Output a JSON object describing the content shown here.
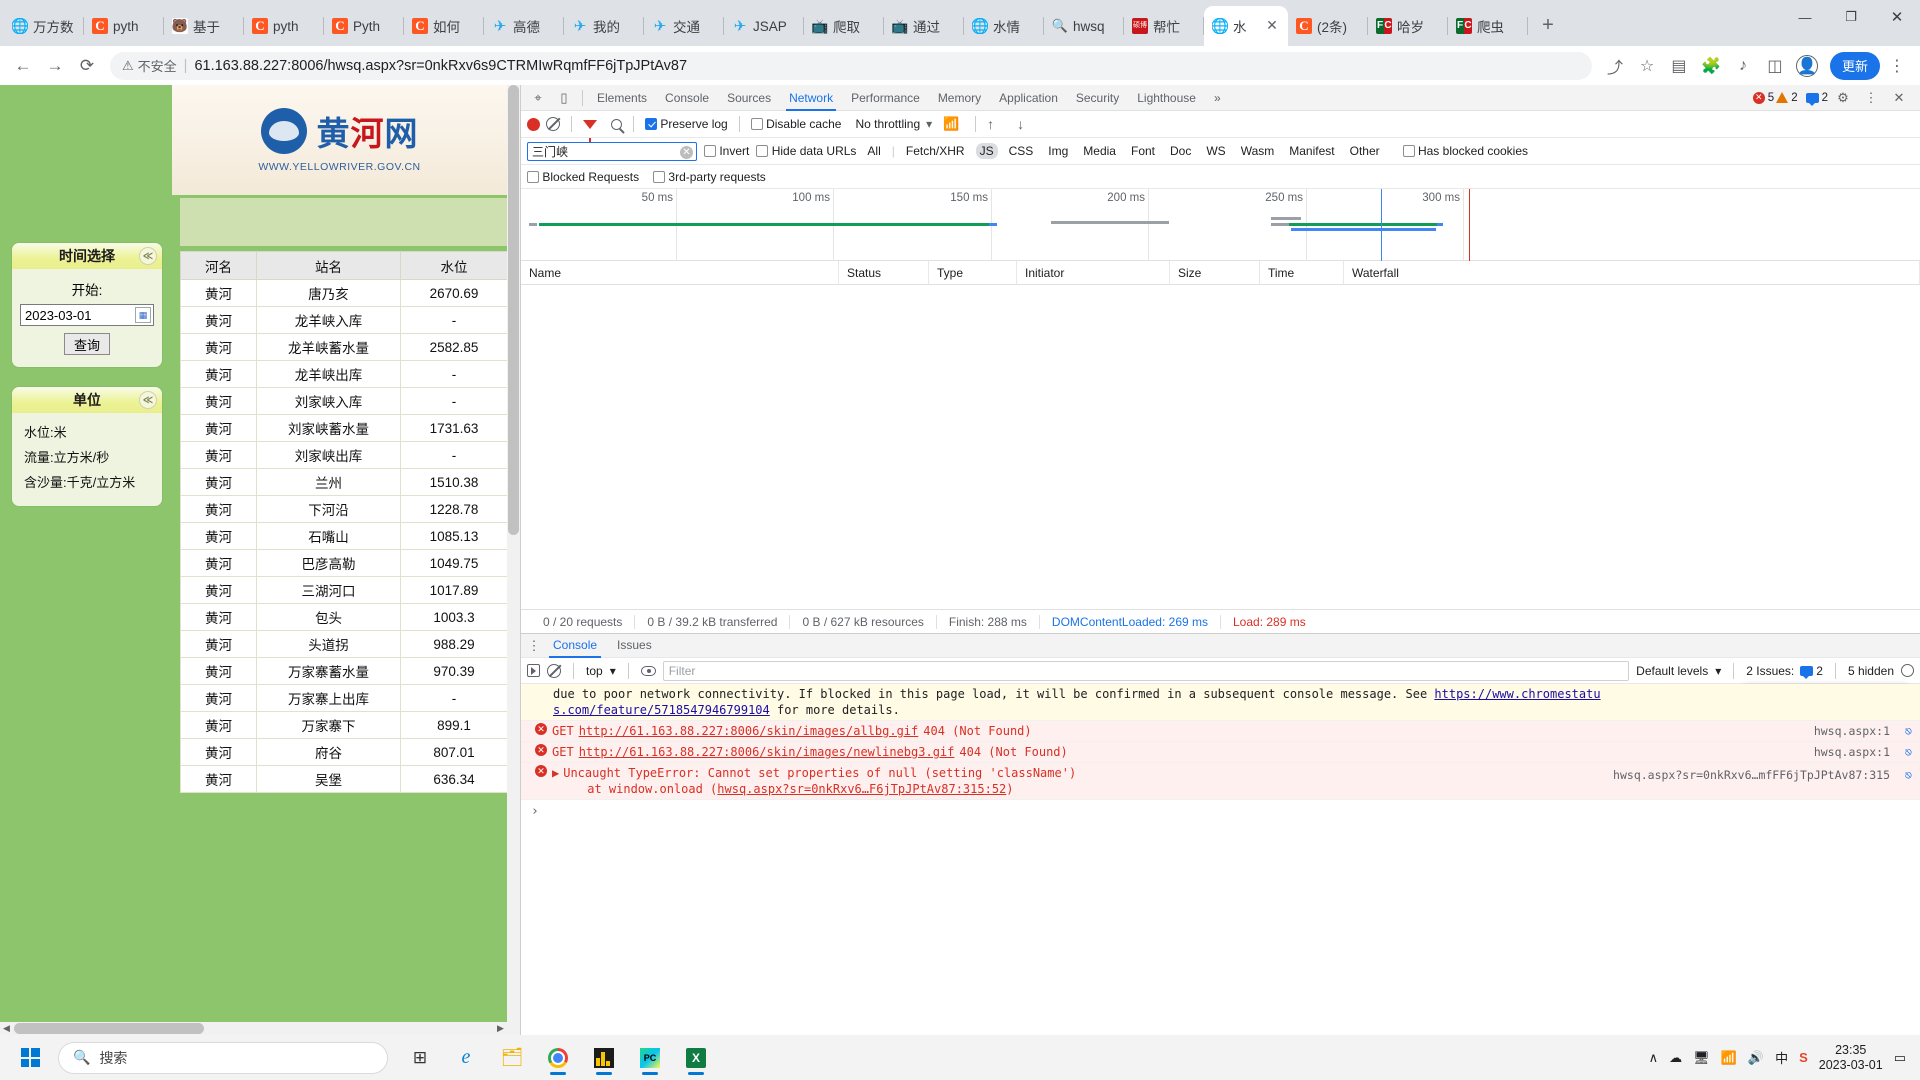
{
  "browser": {
    "tabs": [
      {
        "title": "万方数",
        "icon": "globe-icon"
      },
      {
        "title": "pyth",
        "icon": "csdn-icon"
      },
      {
        "title": "基于",
        "icon": "baidu-icon"
      },
      {
        "title": "pyth",
        "icon": "csdn-icon"
      },
      {
        "title": "Pyth",
        "icon": "csdn-icon"
      },
      {
        "title": "如何",
        "icon": "csdn-icon"
      },
      {
        "title": "高德",
        "icon": "telegram-icon"
      },
      {
        "title": "我的",
        "icon": "telegram-icon"
      },
      {
        "title": "交通",
        "icon": "telegram-icon"
      },
      {
        "title": "JSAP",
        "icon": "telegram-icon"
      },
      {
        "title": "爬取",
        "icon": "bilibili-icon"
      },
      {
        "title": "通过",
        "icon": "bilibili-icon"
      },
      {
        "title": "水情",
        "icon": "globe-icon"
      },
      {
        "title": "hwsq",
        "icon": "search-icon"
      },
      {
        "title": "帮忙",
        "icon": "doc-red-icon"
      },
      {
        "title": "水",
        "icon": "globe-icon",
        "active": true
      },
      {
        "title": "(2条)",
        "icon": "csdn-icon"
      },
      {
        "title": "哈岁",
        "icon": "fc-icon"
      },
      {
        "title": "爬虫",
        "icon": "fc-icon"
      }
    ],
    "new_tab_label": "+",
    "window_controls": {
      "minimize": "—",
      "maximize": "❐",
      "close": "✕"
    },
    "toolbar": {
      "back": "←",
      "forward": "→",
      "reload": "⟳",
      "security_label": "不安全",
      "url": "61.163.88.227:8006/hwsq.aspx?sr=0nkRxv6s9CTRMIwRqmfFF6jTpJPtAv87",
      "share_icon": "share-icon",
      "star_icon": "star-icon",
      "sidepanel_icon": "sidepanel-icon",
      "extensions_icon": "puzzle-icon",
      "media_icon": "media-icon",
      "collections_icon": "collections-icon",
      "profile_icon": "profile-icon",
      "update_label": "更新",
      "menu_icon": "kebab-menu-icon"
    }
  },
  "webpage": {
    "logo": {
      "text_black": "黄",
      "text_red": "河",
      "text_black2": "网",
      "subtitle": "WWW.YELLOWRIVER.GOV.CN"
    },
    "time_panel": {
      "title": "时间选择",
      "start_label": "开始:",
      "date_value": "2023-03-01",
      "query_label": "查询",
      "collapse_icon": "chevron-up-icon",
      "calendar_icon": "calendar-icon"
    },
    "unit_panel": {
      "title": "单位",
      "collapse_icon": "chevron-up-icon",
      "lines": [
        "水位:米",
        "流量:立方米/秒",
        "含沙量:千克/立方米"
      ]
    },
    "table": {
      "headers": [
        "河名",
        "站名",
        "水位"
      ],
      "rows": [
        [
          "黄河",
          "唐乃亥",
          "2670.69"
        ],
        [
          "黄河",
          "龙羊峡入库",
          "-"
        ],
        [
          "黄河",
          "龙羊峡蓄水量",
          "2582.85"
        ],
        [
          "黄河",
          "龙羊峡出库",
          "-"
        ],
        [
          "黄河",
          "刘家峡入库",
          "-"
        ],
        [
          "黄河",
          "刘家峡蓄水量",
          "1731.63"
        ],
        [
          "黄河",
          "刘家峡出库",
          "-"
        ],
        [
          "黄河",
          "兰州",
          "1510.38"
        ],
        [
          "黄河",
          "下河沿",
          "1228.78"
        ],
        [
          "黄河",
          "石嘴山",
          "1085.13"
        ],
        [
          "黄河",
          "巴彦高勒",
          "1049.75"
        ],
        [
          "黄河",
          "三湖河口",
          "1017.89"
        ],
        [
          "黄河",
          "包头",
          "1003.3"
        ],
        [
          "黄河",
          "头道拐",
          "988.29"
        ],
        [
          "黄河",
          "万家寨蓄水量",
          "970.39"
        ],
        [
          "黄河",
          "万家寨上出库",
          "-"
        ],
        [
          "黄河",
          "万家寨下",
          "899.1"
        ],
        [
          "黄河",
          "府谷",
          "807.01"
        ],
        [
          "黄河",
          "吴堡",
          "636.34"
        ]
      ]
    }
  },
  "devtools": {
    "panel_tabs": [
      "Elements",
      "Console",
      "Sources",
      "Network",
      "Performance",
      "Memory",
      "Application",
      "Security",
      "Lighthouse"
    ],
    "selected_panel": "Network",
    "overflow_label": "»",
    "inspect_icon": "inspect-cursor-icon",
    "device_icon": "device-toolbar-icon",
    "settings_icon": "gear-icon",
    "more_icon": "kebab-menu-icon",
    "close_icon": "close-icon",
    "counters": {
      "errors": "5",
      "warnings": "2",
      "messages": "2"
    },
    "network_toolbar": {
      "record_label": "record-button",
      "clear_label": "clear-button",
      "filter_icon": "funnel-icon",
      "search_icon": "search-icon",
      "preserve_log": "Preserve log",
      "preserve_log_checked": true,
      "disable_cache": "Disable cache",
      "disable_cache_checked": false,
      "throttling": "No throttling",
      "wifi_icon": "network-conditions-icon",
      "import_icon": "import-har-icon",
      "export_icon": "export-har-icon"
    },
    "filter_bar": {
      "filter_value": "三门峡",
      "clear_icon": "clear-input-icon",
      "invert": "Invert",
      "hide_data_urls": "Hide data URLs",
      "types": [
        "All",
        "Fetch/XHR",
        "JS",
        "CSS",
        "Img",
        "Media",
        "Font",
        "Doc",
        "WS",
        "Wasm",
        "Manifest",
        "Other"
      ],
      "selected_type": "JS",
      "has_blocked_cookies": "Has blocked cookies",
      "blocked_requests": "Blocked Requests",
      "third_party_requests": "3rd-party requests"
    },
    "overview_ticks": [
      "50 ms",
      "100 ms",
      "150 ms",
      "200 ms",
      "250 ms",
      "300 ms"
    ],
    "request_columns": [
      "Name",
      "Status",
      "Type",
      "Initiator",
      "Size",
      "Time",
      "Waterfall"
    ],
    "status_bar": {
      "requests": "0 / 20 requests",
      "transferred": "0 B / 39.2 kB transferred",
      "resources": "0 B / 627 kB resources",
      "finish": "Finish: 288 ms",
      "dom_content_loaded": "DOMContentLoaded: 269 ms",
      "load": "Load: 289 ms"
    },
    "drawer": {
      "tabs": [
        "Console",
        "Issues"
      ],
      "selected": "Console",
      "toolbar": {
        "execute_icon": "execution-context-icon",
        "clear_icon": "clear-console-icon",
        "context": "top",
        "context_caret": "▾",
        "eye_icon": "live-expression-icon",
        "filter_placeholder": "Filter",
        "levels": "Default levels",
        "levels_caret": "▾",
        "issues": "2 Issues:",
        "issues_count": "2",
        "hidden": "5 hidden",
        "settings_icon": "gear-icon"
      },
      "messages": [
        {
          "type": "warning",
          "text_lines": [
            "due to poor network connectivity. If blocked in this page load, it will be confirmed in a subsequent console message. See ",
            "s.com/feature/5718547946799104 for more details."
          ],
          "link_tail": "https://www.chromestatu",
          "link_line2": "s.com/feature/5718547946799104",
          "line2_tail": " for more details."
        },
        {
          "type": "error",
          "method": "GET",
          "url": "http://61.163.88.227:8006/skin/images/allbg.gif",
          "status": "404 (Not Found)",
          "source": "hwsq.aspx:1"
        },
        {
          "type": "error",
          "method": "GET",
          "url": "http://61.163.88.227:8006/skin/images/newlinebg3.gif",
          "status": "404 (Not Found)",
          "source": "hwsq.aspx:1"
        },
        {
          "type": "error",
          "text": "Uncaught TypeError: Cannot set properties of null (setting 'className')",
          "at_text": "at window.onload (",
          "at_link": "hwsq.aspx?sr=0nkRxv6…F6jTpJPtAv87:315:52",
          "at_tail": ")",
          "source": "hwsq.aspx?sr=0nkRxv6…mfFF6jTpJPtAv87:315",
          "expand_icon": "expand-triangle-icon"
        }
      ],
      "prompt": "›"
    }
  },
  "taskbar": {
    "start_icon": "windows-start-icon",
    "search_placeholder": "搜索",
    "search_icon": "search-icon",
    "apps": [
      {
        "name": "task-view-icon",
        "glyph": "⧉"
      },
      {
        "name": "edge-icon",
        "glyph": "e"
      },
      {
        "name": "file-explorer-icon",
        "glyph": "📁"
      },
      {
        "name": "chrome-icon",
        "glyph": "●",
        "running": true
      },
      {
        "name": "app-chart-icon",
        "glyph": "▤",
        "running": true
      },
      {
        "name": "pycharm-icon",
        "glyph": "PC",
        "running": true
      },
      {
        "name": "excel-icon",
        "glyph": "X",
        "running": true
      }
    ],
    "tray": {
      "chevron": "∧",
      "cloud_icon": "cloud-icon",
      "monitor_icon": "monitor-icon",
      "wifi_icon": "wifi-icon",
      "volume_icon": "volume-icon",
      "ime": "中",
      "sogou_icon": "sogou-icon",
      "time": "23:35",
      "date": "2023-03-01",
      "notify_icon": "notification-icon"
    }
  }
}
